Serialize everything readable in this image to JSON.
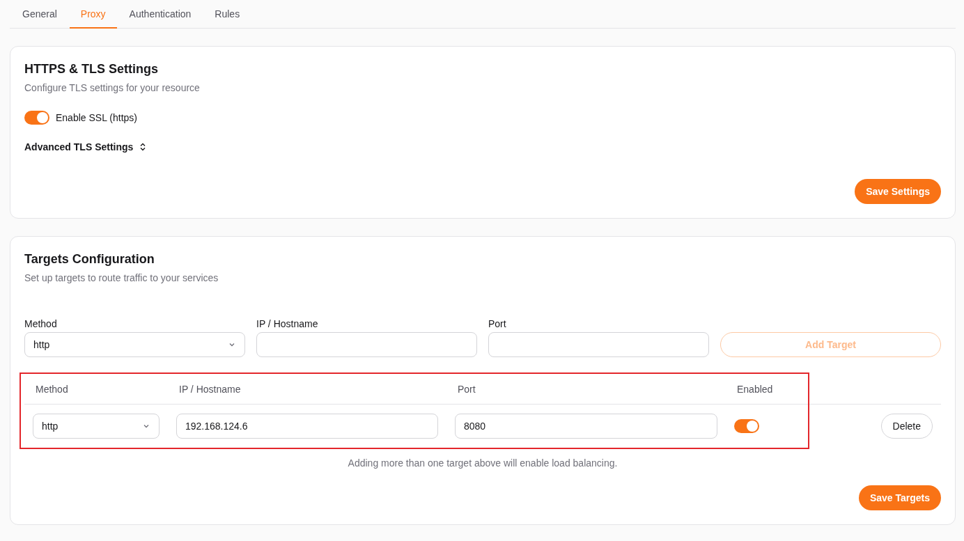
{
  "tabs": [
    {
      "label": "General",
      "selected": false
    },
    {
      "label": "Proxy",
      "selected": true
    },
    {
      "label": "Authentication",
      "selected": false
    },
    {
      "label": "Rules",
      "selected": false
    }
  ],
  "tls_card": {
    "title": "HTTPS & TLS Settings",
    "description": "Configure TLS settings for your resource",
    "ssl_toggle": {
      "label": "Enable SSL (https)",
      "on": true
    },
    "advanced": {
      "label": "Advanced TLS Settings"
    },
    "save_button": "Save Settings"
  },
  "targets_card": {
    "title": "Targets Configuration",
    "description": "Set up targets to route traffic to your services",
    "form": {
      "fields": [
        {
          "label": "Method",
          "kind": "select",
          "value": "http"
        },
        {
          "label": "IP / Hostname",
          "kind": "input"
        },
        {
          "label": "Port",
          "kind": "input"
        }
      ],
      "add_button": {
        "label": "Add Target",
        "disabled": true
      }
    },
    "table": {
      "columns": [
        "Method",
        "IP / Hostname",
        "Port",
        "Enabled"
      ],
      "rows": [
        {
          "method": "http",
          "host": "192.168.124.6",
          "port": "8080",
          "enabled": true,
          "action": "Delete"
        }
      ]
    },
    "note": "Adding more than one target above will enable load balancing.",
    "save_button": "Save Targets"
  }
}
